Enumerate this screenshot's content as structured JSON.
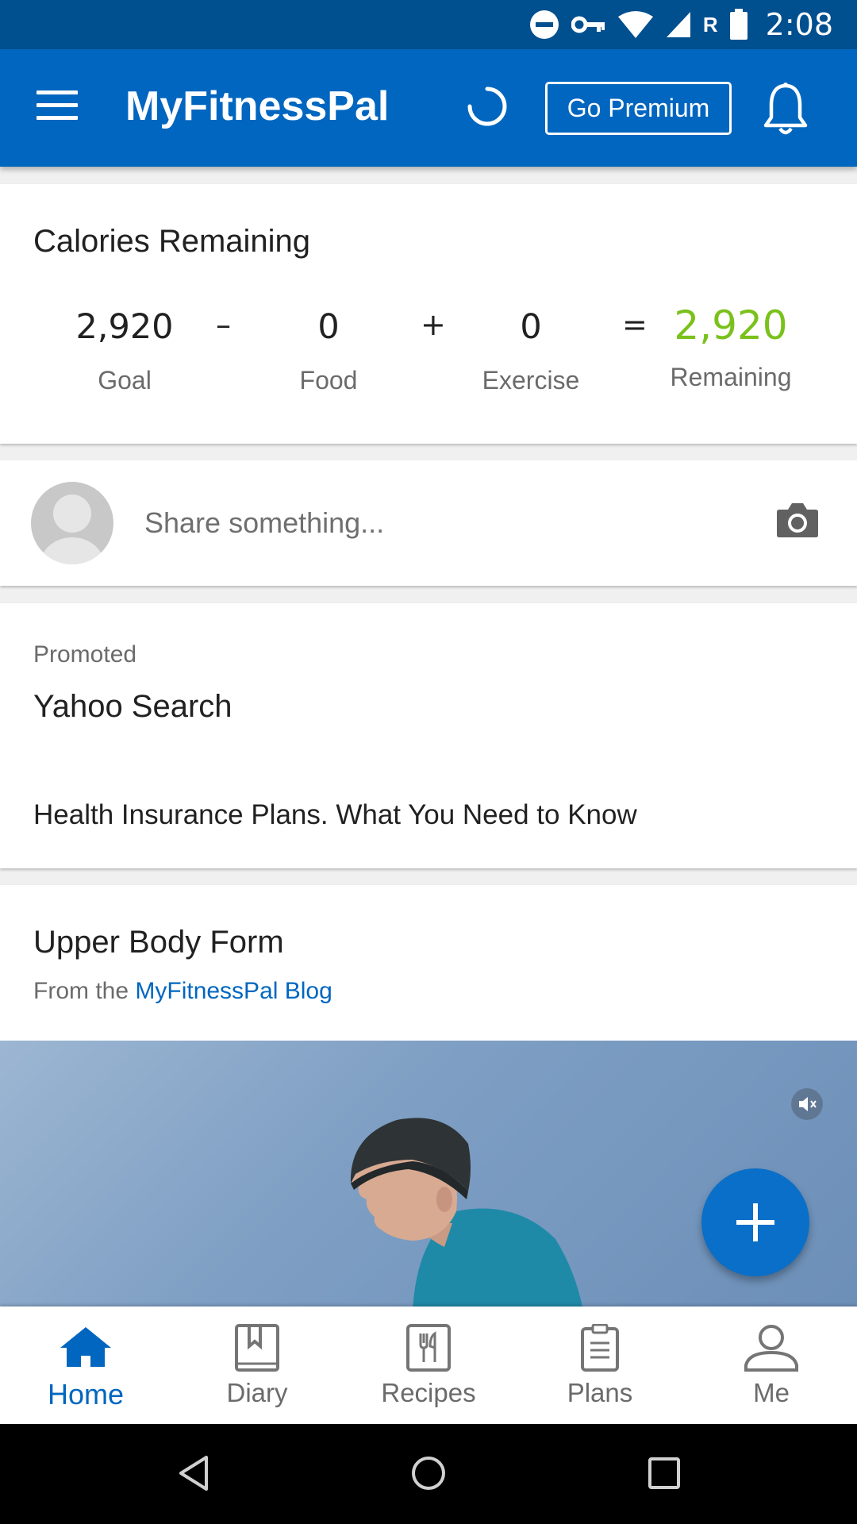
{
  "status_bar": {
    "time": "2:08",
    "roaming_indicator": "R",
    "icons": [
      "do-not-disturb-icon",
      "vpn-key-icon",
      "wifi-icon",
      "signal-icon",
      "battery-icon"
    ]
  },
  "app_bar": {
    "title": "MyFitnessPal",
    "premium_label": "Go Premium",
    "icons": [
      "menu-icon",
      "loading-spinner-icon",
      "bell-icon"
    ]
  },
  "calories": {
    "title": "Calories Remaining",
    "goal": {
      "value": "2,920",
      "label": "Goal"
    },
    "food": {
      "value": "0",
      "label": "Food"
    },
    "exercise": {
      "value": "0",
      "label": "Exercise"
    },
    "remaining": {
      "value": "2,920",
      "label": "Remaining"
    },
    "operators": {
      "minus": "–",
      "plus": "+",
      "equals": "="
    },
    "remaining_color": "#7ac11c"
  },
  "share": {
    "placeholder": "Share something...",
    "icons": [
      "avatar-placeholder-icon",
      "camera-icon"
    ]
  },
  "promoted": {
    "label": "Promoted",
    "title": "Yahoo Search",
    "text": "Health Insurance Plans. What You Need to Know"
  },
  "blog": {
    "title": "Upper Body Form",
    "from_prefix": "From the",
    "from_link": "MyFitnessPal Blog",
    "icons": [
      "mute-icon"
    ]
  },
  "fab": {
    "icon": "plus-icon"
  },
  "bottom_nav": {
    "items": [
      {
        "label": "Home",
        "icon": "home-icon",
        "active": true
      },
      {
        "label": "Diary",
        "icon": "diary-icon",
        "active": false
      },
      {
        "label": "Recipes",
        "icon": "recipes-icon",
        "active": false
      },
      {
        "label": "Plans",
        "icon": "plans-icon",
        "active": false
      },
      {
        "label": "Me",
        "icon": "person-icon",
        "active": false
      }
    ]
  },
  "system_nav": {
    "icons": [
      "back-icon",
      "home-circle-icon",
      "recents-icon"
    ]
  },
  "colors": {
    "brand_blue": "#0066bf",
    "status_bar": "#004f8f",
    "accent_green": "#7ac11c"
  }
}
